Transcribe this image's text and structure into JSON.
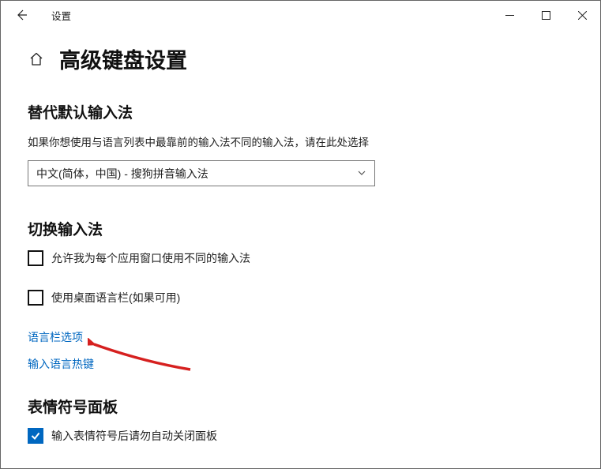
{
  "titlebar": {
    "title": "设置"
  },
  "page": {
    "heading": "高级键盘设置"
  },
  "section1": {
    "heading": "替代默认输入法",
    "desc": "如果你想使用与语言列表中最靠前的输入法不同的输入法，请在此处选择",
    "dropdown_value": "中文(简体，中国) - 搜狗拼音输入法"
  },
  "section2": {
    "heading": "切换输入法",
    "checkbox1": "允许我为每个应用窗口使用不同的输入法",
    "checkbox2": "使用桌面语言栏(如果可用)",
    "link1": "语言栏选项",
    "link2": "输入语言热键"
  },
  "section3": {
    "heading": "表情符号面板",
    "checkbox1": "输入表情符号后请勿自动关闭面板"
  }
}
